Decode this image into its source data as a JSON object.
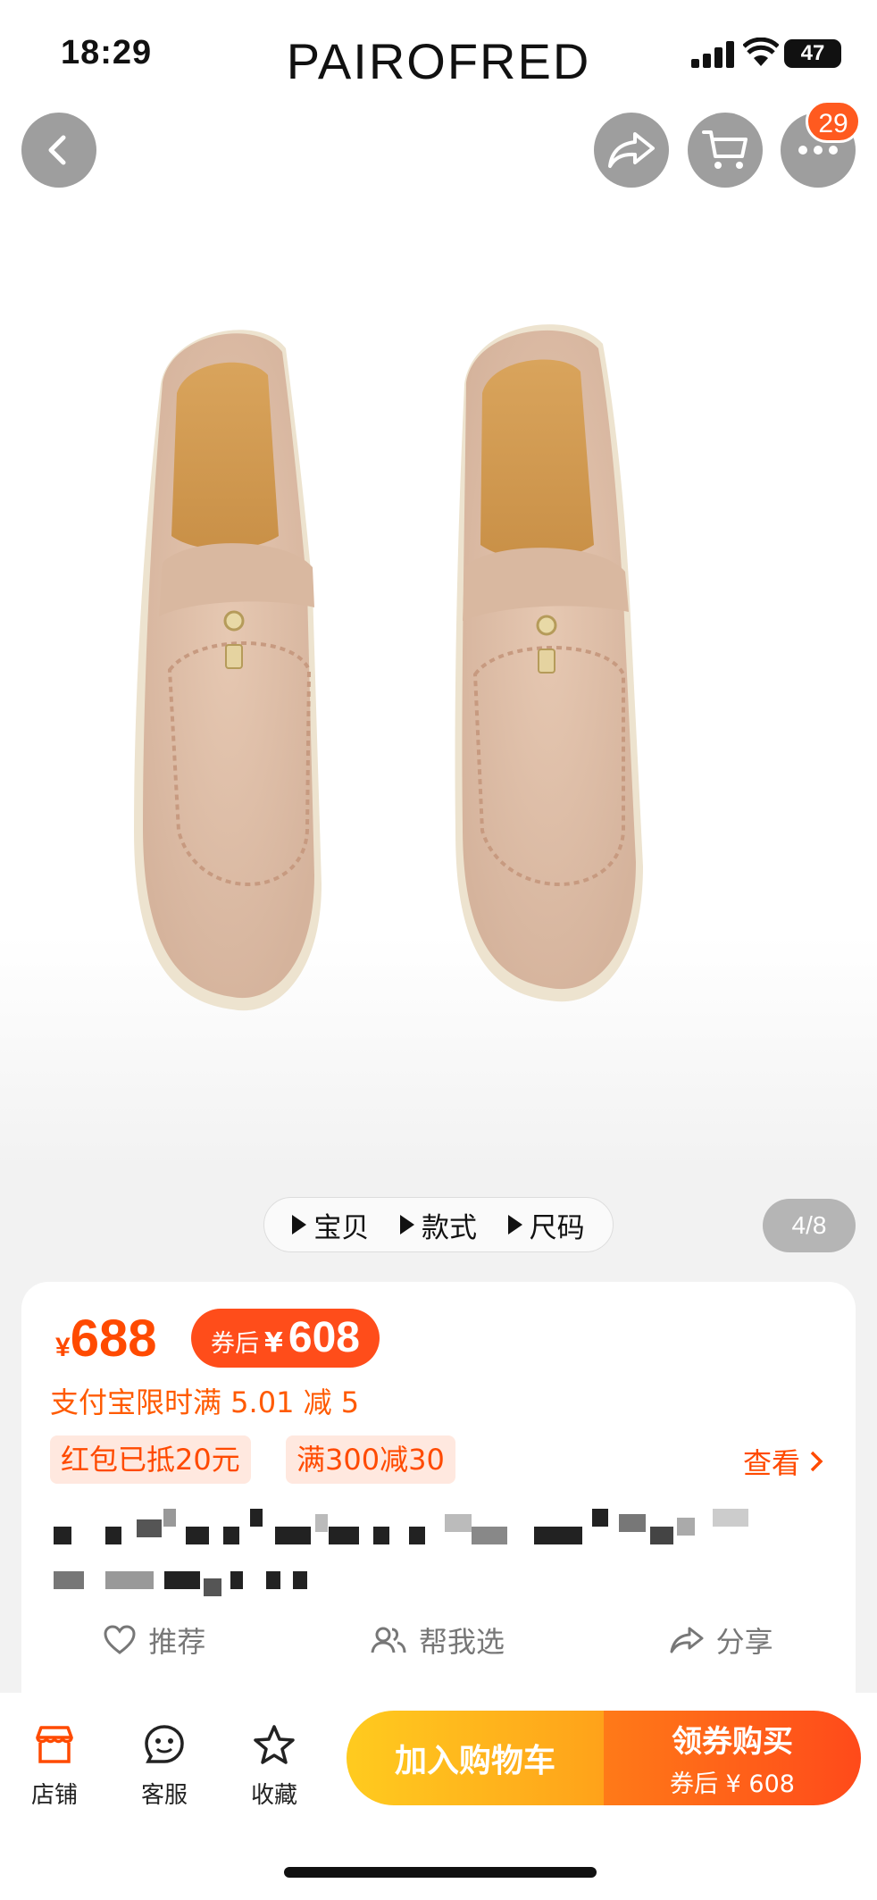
{
  "status_bar": {
    "time": "18:29",
    "battery": "47"
  },
  "header": {
    "brand": "PAIROFRED",
    "cart_badge": "29"
  },
  "icons": {
    "back": "chevron-left-icon",
    "share": "share-arrow-icon",
    "cart": "cart-icon",
    "more": "more-dots-icon"
  },
  "gallery": {
    "tabs": [
      {
        "label": "宝贝"
      },
      {
        "label": "款式"
      },
      {
        "label": "尺码"
      }
    ],
    "counter": "4/8"
  },
  "price": {
    "currency": "¥",
    "current": "688",
    "coupon_label": "券后",
    "coupon_currency": "¥",
    "coupon_price": "608",
    "promo": "支付宝限时满 5.01 减 5",
    "tags": [
      "红包已抵20元",
      "满300减30"
    ],
    "view_more": "查看"
  },
  "actions": [
    {
      "label": "推荐",
      "icon": "heart-icon"
    },
    {
      "label": "帮我选",
      "icon": "people-icon"
    },
    {
      "label": "分享",
      "icon": "share-icon"
    }
  ],
  "bottom_nav": [
    {
      "label": "店铺",
      "icon": "store-icon"
    },
    {
      "label": "客服",
      "icon": "service-icon"
    },
    {
      "label": "收藏",
      "icon": "star-icon"
    }
  ],
  "cta": {
    "add_to_cart": "加入购物车",
    "buy_title": "领券购买",
    "buy_sub": "券后 ¥ 608"
  },
  "colors": {
    "accent": "#ff4a00",
    "cart_gradient": "#ffb81e",
    "buy_gradient": "#ff5a1a"
  }
}
